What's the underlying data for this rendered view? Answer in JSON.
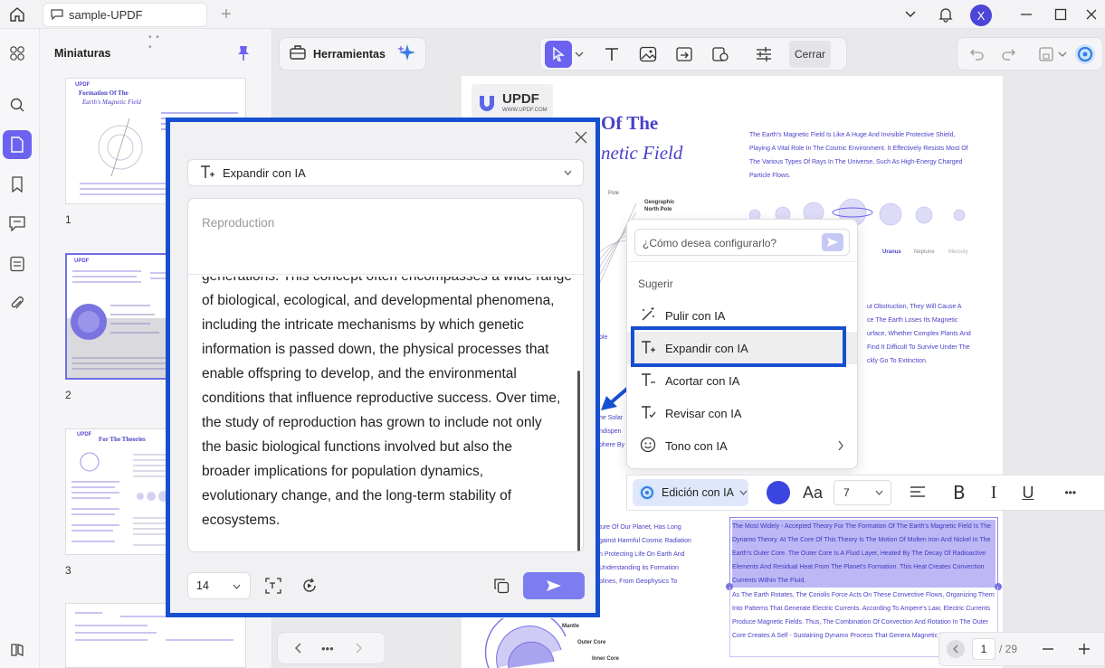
{
  "window": {
    "tab_title": "sample-UPDF",
    "user_initial": "X"
  },
  "sidebar": {
    "title": "Miniaturas",
    "thumbnails": [
      {
        "page": "1"
      },
      {
        "page": "2"
      },
      {
        "page": "3"
      }
    ],
    "thumb_texts": {
      "t1_title": "Formation Of The",
      "t1_sub": "Earth's Magnetic Field",
      "t3_title": "For The Theories"
    }
  },
  "toolbar": {
    "tools_label": "Herramientas",
    "close_label": "Cerrar"
  },
  "document": {
    "logo_text": "UPDF",
    "logo_url": "WWW.UPDF.COM",
    "title_line1": "Of The",
    "title_line2": "netic Field",
    "intro": "The Earth's Magnetic Field Is Like A Huge And Invisible Protective Shield, Playing A Vital Role In The Cosmic Environment. It Effectively Resists Most Of The Various Types Of Rays In The Universe, Such As High-Energy Charged Particle Flows.",
    "geo_pole": "Geographic North Pole",
    "pole_small": "Pole",
    "planets": [
      "Uranus",
      "Neptune",
      "Mercury"
    ],
    "mid_text": "ut Obstruction, They Will Cause A\nce The Earth Loses Its Magnetic\nurface, Whether Complex Plants And\nFind It Difficult To Survive Under The\nckly Go To Extinction.",
    "side_snips": [
      "ole",
      "he Solar",
      "ndispen",
      "phere By"
    ],
    "left_lower": "ture Of Our Planet, Has Long\ngainst Harmful Cosmic Radiation\nn Protecting Life On Earth And\nUnderstanding its Formation\nplines, From Geophysics To",
    "selected_text": "The Most Widely - Accepted Theory For The Formation Of The Earth's Magnetic Field Is The Dynamo Theory. At The Core Of This Theory Is The Motion Of Molten Iron And Nickel In The Earth's Outer Core. The Outer Core Is A Fluid Layer, Heated By The Decay Of Radioactive Elements And Residual Heat From The Planet's Formation. This Heat Creates Convection Currents Within The Fluid.",
    "after_text": "As The Earth Rotates, The Coriolis Force Acts On These Convective Flows, Organizing Them Into Patterns That Generate Electric Currents. According To Ampere's Law, Electric Currents Produce Magnetic Fields. Thus, The Combination Of Convection And Rotation In The Outer Core Creates A Self - Sustaining Dynamo Process That Genera Magnetic Field.",
    "diagram_labels": [
      "Mantle",
      "Outer Core",
      "Inner Core"
    ]
  },
  "ai_dialog": {
    "mode_label": "Expandir con IA",
    "prompt_text": "Reproduction",
    "partial_line": "generations. This concept often encompasses a wide range",
    "output_text": "of biological, ecological, and developmental phenomena,\nincluding the intricate mechanisms by which genetic\ninformation is passed down, the physical processes that\nenable offspring to develop, and the environmental\nconditions that influence reproductive success. Over time,\nthe study of reproduction has grown to include not only\nthe basic biological functions involved but also the\nbroader implications for population dynamics,\nevolutionary change, and the long-term stability of\necosystems.",
    "font_size": "14"
  },
  "ai_menu": {
    "input_placeholder": "¿Cómo desea configurarlo?",
    "section_label": "Sugerir",
    "items": [
      {
        "label": "Pulir con IA"
      },
      {
        "label": "Expandir con IA"
      },
      {
        "label": "Acortar con IA"
      },
      {
        "label": "Revisar con IA"
      },
      {
        "label": "Tono con IA"
      }
    ]
  },
  "format_bar": {
    "ai_edit_label": "Edición con IA",
    "font_size": "7",
    "text_color": "#3b46e0"
  },
  "pagination": {
    "current": "1",
    "total": "/ 29"
  },
  "colors": {
    "accent": "#6b63f0",
    "highlight_border": "#1650d0",
    "doc_text": "#4a41c6"
  }
}
